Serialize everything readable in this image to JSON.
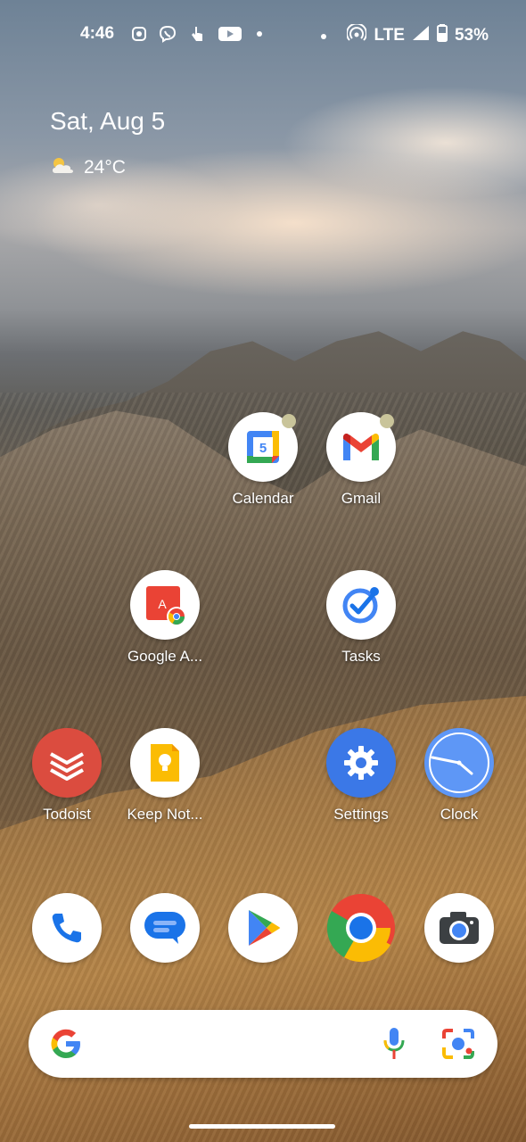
{
  "status_bar": {
    "time": "4:46",
    "network": "LTE",
    "battery": "53%"
  },
  "glance": {
    "date": "Sat, Aug 5",
    "temperature": "24°C",
    "weather_icon": "partly-cloudy-icon"
  },
  "apps": {
    "calendar": {
      "label": "Calendar",
      "day": "5",
      "has_notification": true
    },
    "gmail": {
      "label": "Gmail",
      "has_notification": true
    },
    "google_apps": {
      "label": "Google A...",
      "tile_letter": "A"
    },
    "tasks": {
      "label": "Tasks"
    },
    "todoist": {
      "label": "Todoist"
    },
    "keep_notes": {
      "label": "Keep Not..."
    },
    "settings": {
      "label": "Settings"
    },
    "clock": {
      "label": "Clock"
    }
  },
  "dock": [
    "phone-icon",
    "messages-icon",
    "play-store-icon",
    "chrome-icon",
    "camera-icon"
  ],
  "search": {
    "logo": "google-g-logo",
    "mic_icon": "microphone-icon",
    "lens_icon": "google-lens-icon"
  },
  "colors": {
    "google_blue": "#4285F4",
    "google_red": "#EA4335",
    "google_yellow": "#FBBC04",
    "google_green": "#34A853",
    "todoist_red": "#DB4C3F",
    "settings_blue": "#3B78E7",
    "clock_blue": "#5E97F6"
  }
}
